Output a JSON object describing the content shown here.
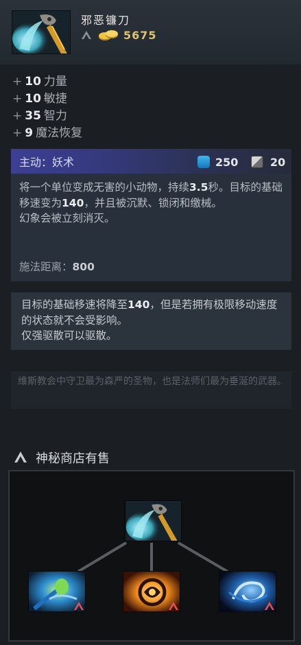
{
  "item": {
    "name": "邪恶镰刀",
    "cost": "5675",
    "icon": "scythe-icon"
  },
  "attributes": [
    {
      "plus": "+",
      "value": "10",
      "name": "力量"
    },
    {
      "plus": "+",
      "value": "10",
      "name": "敏捷"
    },
    {
      "plus": "+",
      "value": "35",
      "name": "智力"
    },
    {
      "plus": "+",
      "value": "9",
      "name": "魔法恢复"
    }
  ],
  "active": {
    "title": "主动：妖术",
    "mana_cost": "250",
    "cooldown": "20",
    "desc_part1": "将一个单位变成无害的小动物，持续",
    "desc_duration": "3.5",
    "desc_part2": "秒。目标的基础移速变为",
    "desc_speed": "140",
    "desc_part3": "，并且被沉默、锁闭和缴械。",
    "desc_line2": "幻象会被立刻消灭。",
    "cast_range_label": "施法距离：",
    "cast_range_value": "800"
  },
  "note": {
    "part1": "目标的基础移速将降至",
    "speed": "140",
    "part2": "，但是若拥有极限移动速度的状态就不会受影响。",
    "line2": "仅强驱散可以驱散。"
  },
  "lore": "维斯教会中守卫最为森严的圣物，也是法师们最为垂涎的武器。",
  "shop": {
    "heading": "神秘商店有售",
    "icon": "secret-shop-icon"
  },
  "colors": {
    "gold": "#e0c26a",
    "mana": "#2a9ad6",
    "active_header": "#3c3f93",
    "secret_mark": "#e35252"
  },
  "recipe": {
    "result_icon": "scythe-icon",
    "components": [
      {
        "icon": "green-staff-icon",
        "secret_shop": true
      },
      {
        "icon": "mystic-orb-icon",
        "secret_shop": true
      },
      {
        "icon": "blue-swirl-icon",
        "secret_shop": true
      }
    ]
  }
}
